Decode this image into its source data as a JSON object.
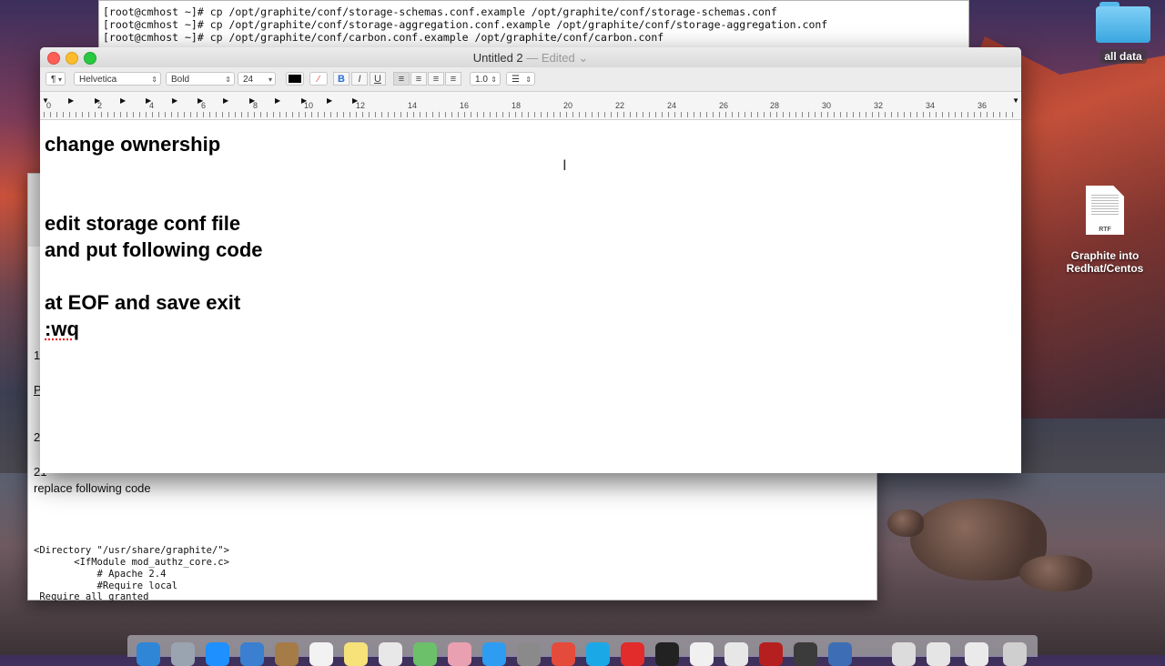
{
  "terminal": {
    "lines": [
      "[root@cmhost ~]# cp /opt/graphite/conf/storage-schemas.conf.example /opt/graphite/conf/storage-schemas.conf",
      "[root@cmhost ~]# cp /opt/graphite/conf/storage-aggregation.conf.example /opt/graphite/conf/storage-aggregation.conf",
      "[root@cmhost ~]# cp /opt/graphite/conf/carbon.conf.example /opt/graphite/conf/carbon.conf"
    ]
  },
  "desktop": {
    "folder_label": "all data",
    "rtf_file_label_1": "Graphite into",
    "rtf_file_label_2": "Redhat/Centos",
    "rtf_badge": "RTF"
  },
  "back_document": {
    "number_1": "1",
    "letter_p": "P",
    "number_2": "2",
    "number_21": "21",
    "text_replace": "replace following code",
    "code_lines": [
      "<Directory \"/usr/share/graphite/\">",
      "       <IfModule mod_authz_core.c>",
      "           # Apache 2.4",
      "           #Require local",
      " Require all granted"
    ]
  },
  "window": {
    "title": "Untitled 2",
    "edited": " — Edited",
    "edited_chevron": "⌄"
  },
  "toolbar": {
    "paragraph_style": "¶",
    "font_family": "Helvetica",
    "font_style": "Bold",
    "font_size": "24",
    "bold": "B",
    "italic": "I",
    "underline": "U",
    "line_spacing": "1.0",
    "list_symbol": "☰"
  },
  "ruler": {
    "ticks": [
      "0",
      "2",
      "4",
      "6",
      "8",
      "10",
      "12",
      "14",
      "16",
      "18",
      "20",
      "22",
      "24",
      "26",
      "28",
      "30",
      "32",
      "34",
      "36"
    ]
  },
  "document": {
    "paragraphs": [
      "change ownership",
      "",
      "",
      "edit storage conf file",
      "and put following code",
      "",
      "at EOF and save exit"
    ],
    "misspelled_line": ":wq"
  },
  "colors": {
    "close": "#fc5f57",
    "minimize": "#fdbc2e",
    "maximize": "#28c840",
    "folder": "#3aa6e0"
  }
}
